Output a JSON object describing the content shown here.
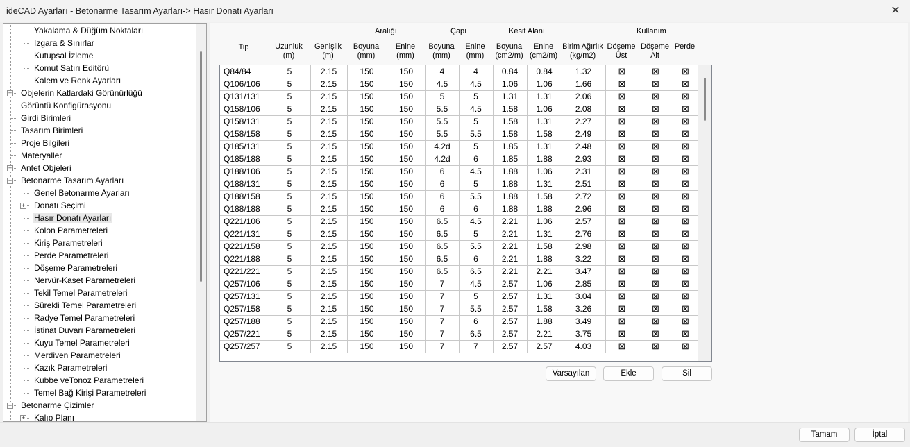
{
  "window": {
    "title": "ideCAD Ayarları - Betonarme Tasarım Ayarları-> Hasır Donatı Ayarları",
    "close": "✕"
  },
  "tree": [
    {
      "label": "Yakalama & Düğüm Noktaları",
      "level": 1
    },
    {
      "label": "Izgara & Sınırlar",
      "level": 1
    },
    {
      "label": "Kutupsal İzleme",
      "level": 1
    },
    {
      "label": "Komut Satırı Editörü",
      "level": 1
    },
    {
      "label": "Kalem ve Renk Ayarları",
      "level": 1
    },
    {
      "label": "Objelerin Katlardaki Görünürlüğü",
      "level": 0,
      "expander": "+"
    },
    {
      "label": "Görüntü Konfigürasyonu",
      "level": 0
    },
    {
      "label": "Girdi Birimleri",
      "level": 0
    },
    {
      "label": "Tasarım Birimleri",
      "level": 0
    },
    {
      "label": "Proje Bilgileri",
      "level": 0
    },
    {
      "label": "Materyaller",
      "level": 0
    },
    {
      "label": "Antet Objeleri",
      "level": 0,
      "expander": "+"
    },
    {
      "label": "Betonarme Tasarım Ayarları",
      "level": 0,
      "expander": "−"
    },
    {
      "label": "Genel Betonarme Ayarları",
      "level": 1
    },
    {
      "label": "Donatı Seçimi",
      "level": 1,
      "expander": "+"
    },
    {
      "label": "Hasır Donatı Ayarları",
      "level": 1,
      "selected": true
    },
    {
      "label": "Kolon Parametreleri",
      "level": 1
    },
    {
      "label": "Kiriş Parametreleri",
      "level": 1
    },
    {
      "label": "Perde Parametreleri",
      "level": 1
    },
    {
      "label": "Döşeme Parametreleri",
      "level": 1
    },
    {
      "label": "Nervür-Kaset Parametreleri",
      "level": 1
    },
    {
      "label": "Tekil Temel Parametreleri",
      "level": 1
    },
    {
      "label": "Sürekli Temel Parametreleri",
      "level": 1
    },
    {
      "label": "Radye Temel Parametreleri",
      "level": 1
    },
    {
      "label": "İstinat Duvarı Parametreleri",
      "level": 1
    },
    {
      "label": "Kuyu Temel Parametreleri",
      "level": 1
    },
    {
      "label": "Merdiven Parametreleri",
      "level": 1
    },
    {
      "label": "Kazık Parametreleri",
      "level": 1
    },
    {
      "label": "Kubbe veTonoz Parametreleri",
      "level": 1
    },
    {
      "label": "Temel Bağ Kirişi Parametreleri",
      "level": 1
    },
    {
      "label": "Betonarme Çizimler",
      "level": 0,
      "expander": "−"
    },
    {
      "label": "Kalıp Planı",
      "level": 1,
      "expander": "+"
    }
  ],
  "groups": {
    "araligi": "Aralığı",
    "capi": "Çapı",
    "kesit": "Kesit Alanı",
    "kullanim": "Kullanım"
  },
  "columns": [
    "Tip",
    "Uzunluk\n(m)",
    "Genişlik\n(m)",
    "Boyuna\n(mm)",
    "Enine\n(mm)",
    "Boyuna\n(mm)",
    "Enine\n(mm)",
    "Boyuna\n(cm2/m)",
    "Enine\n(cm2/m)",
    "Birim Ağırlık\n(kg/m2)",
    "Döşeme\nÜst",
    "Döşeme\nAlt",
    "Perde"
  ],
  "checkbox_glyph": "⊠",
  "rows": [
    [
      "Q84/84",
      "5",
      "2.15",
      "150",
      "150",
      "4",
      "4",
      "0.84",
      "0.84",
      "1.32"
    ],
    [
      "Q106/106",
      "5",
      "2.15",
      "150",
      "150",
      "4.5",
      "4.5",
      "1.06",
      "1.06",
      "1.66"
    ],
    [
      "Q131/131",
      "5",
      "2.15",
      "150",
      "150",
      "5",
      "5",
      "1.31",
      "1.31",
      "2.06"
    ],
    [
      "Q158/106",
      "5",
      "2.15",
      "150",
      "150",
      "5.5",
      "4.5",
      "1.58",
      "1.06",
      "2.08"
    ],
    [
      "Q158/131",
      "5",
      "2.15",
      "150",
      "150",
      "5.5",
      "5",
      "1.58",
      "1.31",
      "2.27"
    ],
    [
      "Q158/158",
      "5",
      "2.15",
      "150",
      "150",
      "5.5",
      "5.5",
      "1.58",
      "1.58",
      "2.49"
    ],
    [
      "Q185/131",
      "5",
      "2.15",
      "150",
      "150",
      "4.2d",
      "5",
      "1.85",
      "1.31",
      "2.48"
    ],
    [
      "Q185/188",
      "5",
      "2.15",
      "150",
      "150",
      "4.2d",
      "6",
      "1.85",
      "1.88",
      "2.93"
    ],
    [
      "Q188/106",
      "5",
      "2.15",
      "150",
      "150",
      "6",
      "4.5",
      "1.88",
      "1.06",
      "2.31"
    ],
    [
      "Q188/131",
      "5",
      "2.15",
      "150",
      "150",
      "6",
      "5",
      "1.88",
      "1.31",
      "2.51"
    ],
    [
      "Q188/158",
      "5",
      "2.15",
      "150",
      "150",
      "6",
      "5.5",
      "1.88",
      "1.58",
      "2.72"
    ],
    [
      "Q188/188",
      "5",
      "2.15",
      "150",
      "150",
      "6",
      "6",
      "1.88",
      "1.88",
      "2.96"
    ],
    [
      "Q221/106",
      "5",
      "2.15",
      "150",
      "150",
      "6.5",
      "4.5",
      "2.21",
      "1.06",
      "2.57"
    ],
    [
      "Q221/131",
      "5",
      "2.15",
      "150",
      "150",
      "6.5",
      "5",
      "2.21",
      "1.31",
      "2.76"
    ],
    [
      "Q221/158",
      "5",
      "2.15",
      "150",
      "150",
      "6.5",
      "5.5",
      "2.21",
      "1.58",
      "2.98"
    ],
    [
      "Q221/188",
      "5",
      "2.15",
      "150",
      "150",
      "6.5",
      "6",
      "2.21",
      "1.88",
      "3.22"
    ],
    [
      "Q221/221",
      "5",
      "2.15",
      "150",
      "150",
      "6.5",
      "6.5",
      "2.21",
      "2.21",
      "3.47"
    ],
    [
      "Q257/106",
      "5",
      "2.15",
      "150",
      "150",
      "7",
      "4.5",
      "2.57",
      "1.06",
      "2.85"
    ],
    [
      "Q257/131",
      "5",
      "2.15",
      "150",
      "150",
      "7",
      "5",
      "2.57",
      "1.31",
      "3.04"
    ],
    [
      "Q257/158",
      "5",
      "2.15",
      "150",
      "150",
      "7",
      "5.5",
      "2.57",
      "1.58",
      "3.26"
    ],
    [
      "Q257/188",
      "5",
      "2.15",
      "150",
      "150",
      "7",
      "6",
      "2.57",
      "1.88",
      "3.49"
    ],
    [
      "Q257/221",
      "5",
      "2.15",
      "150",
      "150",
      "7",
      "6.5",
      "2.57",
      "2.21",
      "3.75"
    ],
    [
      "Q257/257",
      "5",
      "2.15",
      "150",
      "150",
      "7",
      "7",
      "2.57",
      "2.57",
      "4.03"
    ]
  ],
  "buttons": {
    "default": "Varsayılan",
    "add": "Ekle",
    "delete": "Sil",
    "ok": "Tamam",
    "cancel": "İptal"
  }
}
